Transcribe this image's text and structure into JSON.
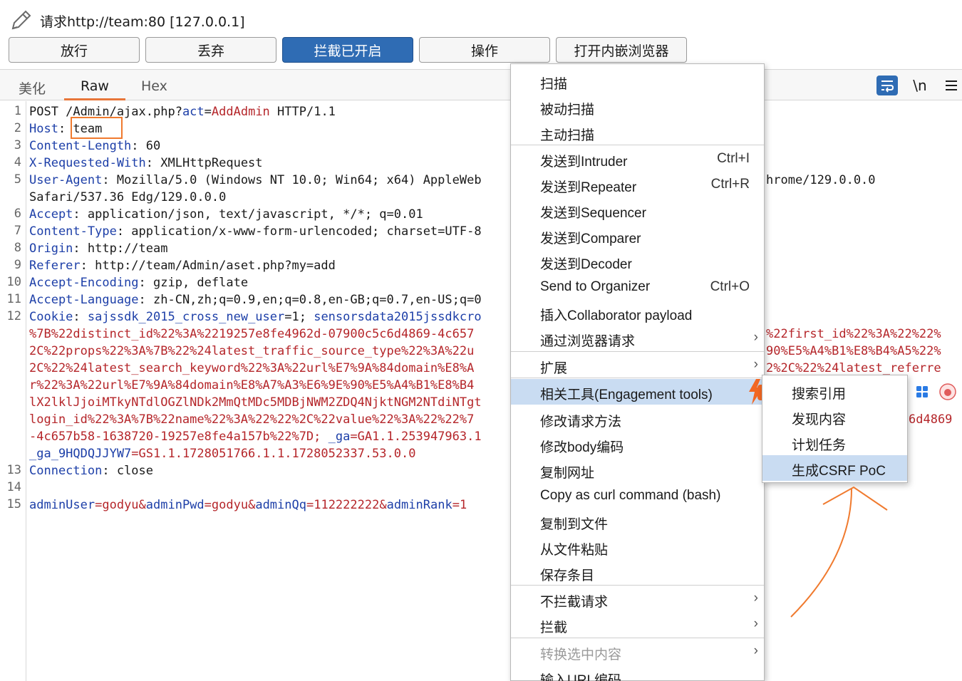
{
  "header": {
    "title": "请求http://team:80  [127.0.0.1]",
    "buttons": {
      "forward": "放行",
      "drop": "丢弃",
      "intercept": "拦截已开启",
      "action": "操作",
      "browser": "打开内嵌浏览器"
    }
  },
  "tabs": {
    "pretty": "美化",
    "raw": "Raw",
    "hex": "Hex",
    "newline_icon": "\\n"
  },
  "editor": {
    "line_numbers": [
      "1",
      "2",
      "3",
      "4",
      "5",
      "6",
      "7",
      "8",
      "9",
      "10",
      "11",
      "12",
      "13",
      "14",
      "15"
    ],
    "l1": {
      "a": "POST /Admin/ajax.php?",
      "b": "act",
      "c": "=",
      "d": "AddAdmin",
      "e": " HTTP/1.1"
    },
    "l2": {
      "k": "Host",
      "v": ": team"
    },
    "l3": {
      "k": "Content-Length",
      "v": ": 60"
    },
    "l4": {
      "k": "X-Requested-With",
      "v": ": XMLHttpRequest"
    },
    "l5": {
      "k": "User-Agent",
      "v": ": Mozilla/5.0 (Windows NT 10.0; Win64; x64) AppleWeb",
      "tail": "hrome/129.0.0.0"
    },
    "l5b": "Safari/537.36 Edg/129.0.0.0",
    "l6": {
      "k": "Accept",
      "v": ": application/json, text/javascript, */*; q=0.01"
    },
    "l7": {
      "k": "Content-Type",
      "v": ": application/x-www-form-urlencoded; charset=UTF-8"
    },
    "l8": {
      "k": "Origin",
      "v": ": http://team"
    },
    "l9": {
      "k": "Referer",
      "v": ": http://team/Admin/aset.php?my=add"
    },
    "l10": {
      "k": "Accept-Encoding",
      "v": ": gzip, deflate"
    },
    "l11": {
      "k": "Accept-Language",
      "v": ": zh-CN,zh;q=0.9,en;q=0.8,en-GB;q=0.7,en-US;q=0"
    },
    "l12": {
      "k": "Cookie",
      "v": ": ",
      "c1": "sajssdk_2015_cross_new_user",
      "c2": "=1; ",
      "c3": "sensorsdata2015jssdkcro"
    },
    "cookie_lines": [
      "%7B%22distinct_id%22%3A%2219257e8fe4962d-07900c5c6d4869-4c657",
      "2C%22props%22%3A%7B%22%24latest_traffic_source_type%22%3A%22u",
      "2C%22%24latest_search_keyword%22%3A%22url%E7%9A%84domain%E8%A",
      "r%22%3A%22url%E7%9A%84domain%E8%A7%A3%E6%9E%90%E5%A4%B1%E8%B4",
      "lX2lklJjoiMTkyNTdlOGZlNDk2MmQtMDc5MDBjNWM2ZDQ4NjktNGM2NTdiNTgt",
      "login_id%22%3A%7B%22name%22%3A%22%22%2C%22value%22%3A%22%22%7",
      "-4c657b58-1638720-19257e8fe4a157b%22%7D; "
    ],
    "cookie_right": [
      "%22first_id%22%3A%22%22%",
      "90%E5%A4%B1%E8%B4%A5%22%",
      "2%2C%22%24latest_referre",
      "6d4869"
    ],
    "ga_key": "_ga",
    "ga_val": "=GA1.1.253947963.1",
    "ga9_key": "_ga_9HQDQJJYW7",
    "ga9_val": "=GS1.1.1728051766.1.1.1728052337.53.0.0",
    "l13": {
      "k": "Connection",
      "v": ": close"
    },
    "l15": {
      "k1": "adminUser",
      "v1": "=godyu&",
      "k2": "adminPwd",
      "v2": "=godyu&",
      "k3": "adminQq",
      "v3": "=112222222&",
      "k4": "adminRank",
      "v4": "=1"
    }
  },
  "context_menu": {
    "items": [
      {
        "label": "扫描"
      },
      {
        "label": "被动扫描"
      },
      {
        "label": "主动扫描"
      },
      {
        "label": "发送到Intruder",
        "shortcut": "Ctrl+I"
      },
      {
        "label": "发送到Repeater",
        "shortcut": "Ctrl+R"
      },
      {
        "label": "发送到Sequencer"
      },
      {
        "label": "发送到Comparer"
      },
      {
        "label": "发送到Decoder"
      },
      {
        "label": "Send to Organizer",
        "shortcut": "Ctrl+O"
      },
      {
        "label": "插入Collaborator payload"
      },
      {
        "label": "通过浏览器请求"
      },
      {
        "label": "扩展"
      },
      {
        "label": "相关工具(Engagement tools)"
      },
      {
        "label": "修改请求方法"
      },
      {
        "label": "修改body编码"
      },
      {
        "label": "复制网址"
      },
      {
        "label": "Copy as curl command (bash)"
      },
      {
        "label": "复制到文件"
      },
      {
        "label": "从文件粘贴"
      },
      {
        "label": "保存条目"
      },
      {
        "label": "不拦截请求"
      },
      {
        "label": "拦截"
      },
      {
        "label": "转换选中内容"
      },
      {
        "label": "输入URL编码"
      }
    ]
  },
  "engagement_submenu": {
    "items": [
      {
        "label": "搜索引用"
      },
      {
        "label": "发现内容"
      },
      {
        "label": "计划任务"
      },
      {
        "label": "生成CSRF PoC"
      }
    ]
  },
  "colors": {
    "accent": "#2f6cb4",
    "highlight": "#c9dcf2",
    "annotation": "#f07a2e",
    "header_key": "#1d3fa8",
    "param_value": "#b5262a"
  }
}
